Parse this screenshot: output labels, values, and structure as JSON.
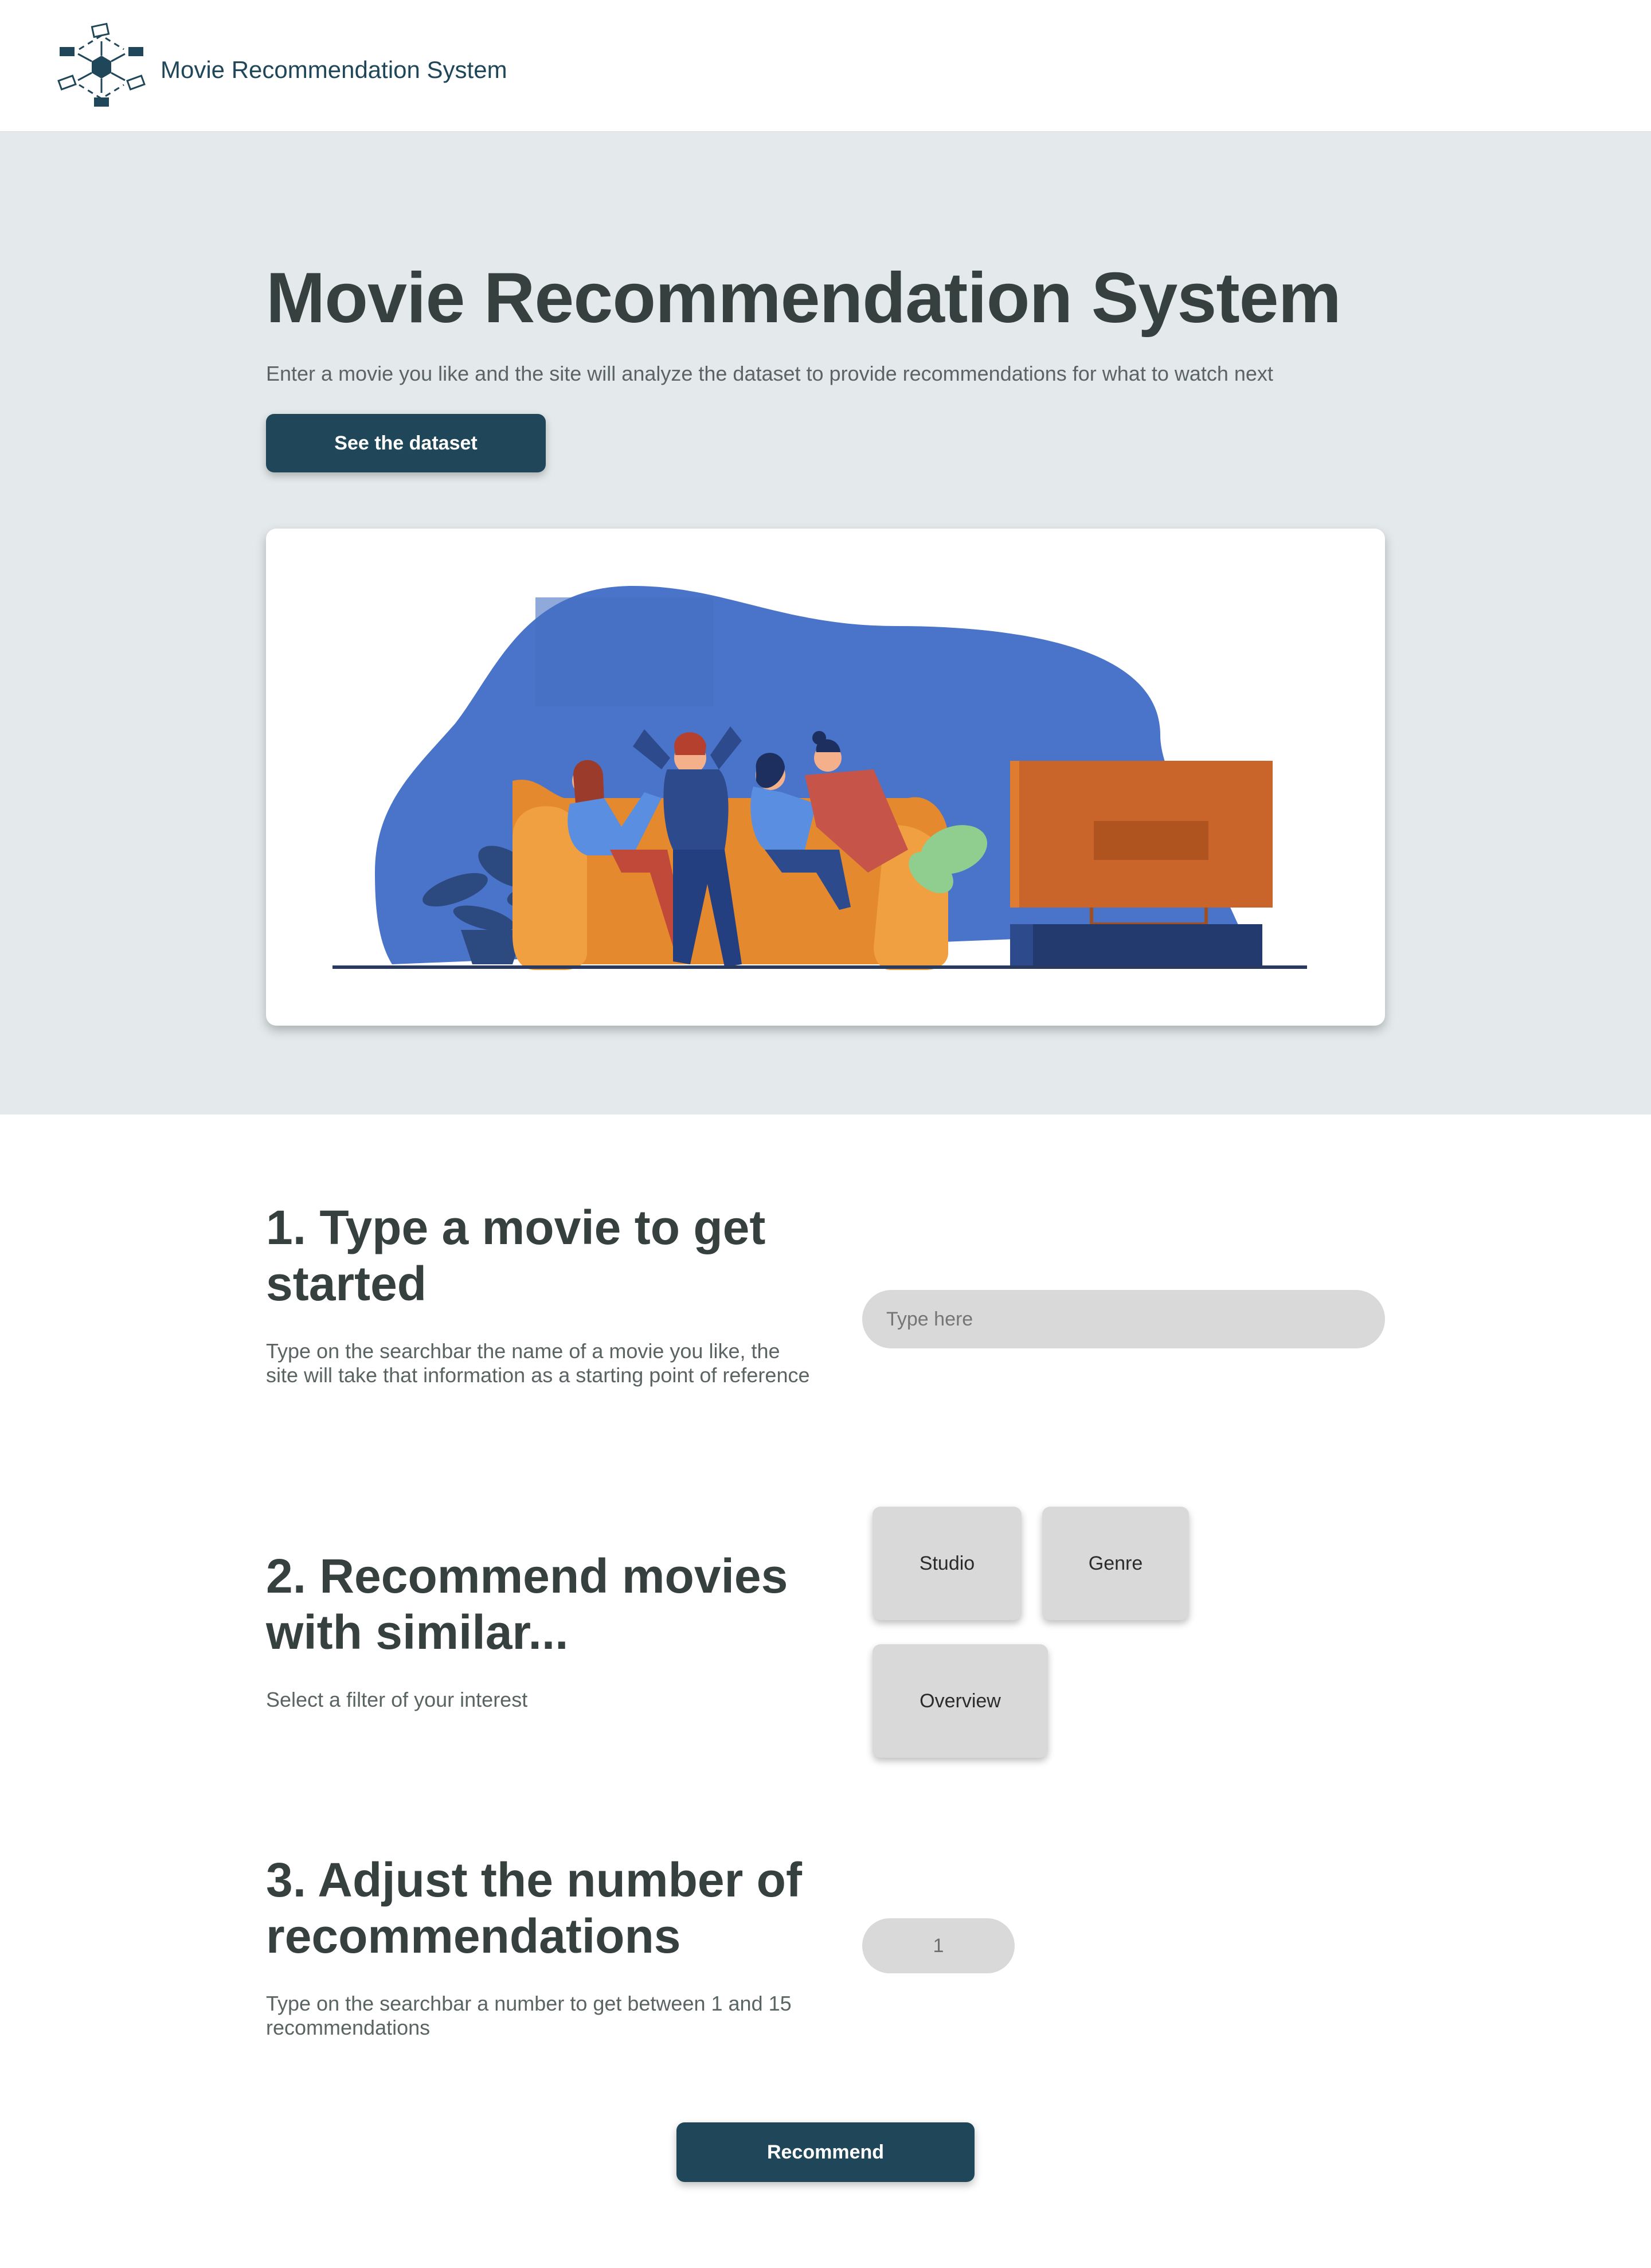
{
  "header": {
    "brand": "Movie Recommendation System",
    "logo_icon": "hexagon-network-icon"
  },
  "hero": {
    "title": "Movie Recommendation System",
    "subtitle": "Enter a movie you like and the site will analyze the dataset to provide recommendations for what to watch next",
    "dataset_button": "See the dataset",
    "illustration": "people-watching-tv-illustration"
  },
  "step1": {
    "title": "1. Type a movie to get started",
    "description": "Type on the searchbar the name of a movie you like, the site will take that information as a starting point of reference",
    "search_placeholder": "Type here"
  },
  "step2": {
    "title": "2. Recommend movies with similar...",
    "description": "Select a filter of your interest",
    "filters": [
      "Studio",
      "Genre",
      "Overview"
    ]
  },
  "step3": {
    "title": "3. Adjust the number of recommendations",
    "description": "Type on the searchbar a number to get between 1 and 15 recommendations",
    "count_value": "1"
  },
  "recommend_button": "Recommend",
  "colors": {
    "primary": "#1f4759",
    "hero_bg": "#e4eaeb",
    "control_bg": "#d9d9d9",
    "text": "#36403f"
  }
}
